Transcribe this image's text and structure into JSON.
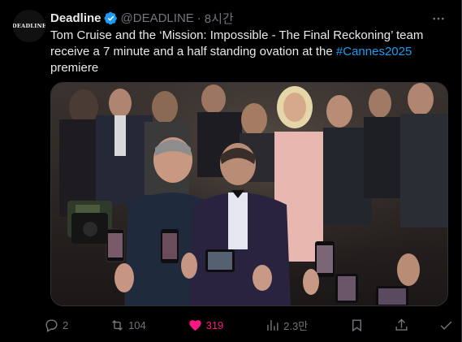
{
  "account": {
    "avatar_text": "DEADLINE",
    "name": "Deadline",
    "handle": "@DEADLINE",
    "separator": "·",
    "time": "8시간"
  },
  "tweet": {
    "text_before": "Tom Cruise and the ‘Mission: Impossible - The Final Reckoning’ team receive a 7 minute and a half standing ovation at the ",
    "hashtag": "#Cannes2025",
    "text_after": " premiere"
  },
  "actions": {
    "replies": "2",
    "reposts": "104",
    "likes": "319",
    "views": "2.3만"
  },
  "colors": {
    "background": "#000000",
    "text": "#e7e9ea",
    "muted": "#71767b",
    "accent": "#1d9bf0",
    "like": "#f91880",
    "verified": "#1d9bf0"
  },
  "icons": [
    "more-icon",
    "verified-badge-icon",
    "reply-icon",
    "repost-icon",
    "like-icon",
    "views-icon",
    "bookmark-icon",
    "share-icon",
    "check-icon"
  ]
}
